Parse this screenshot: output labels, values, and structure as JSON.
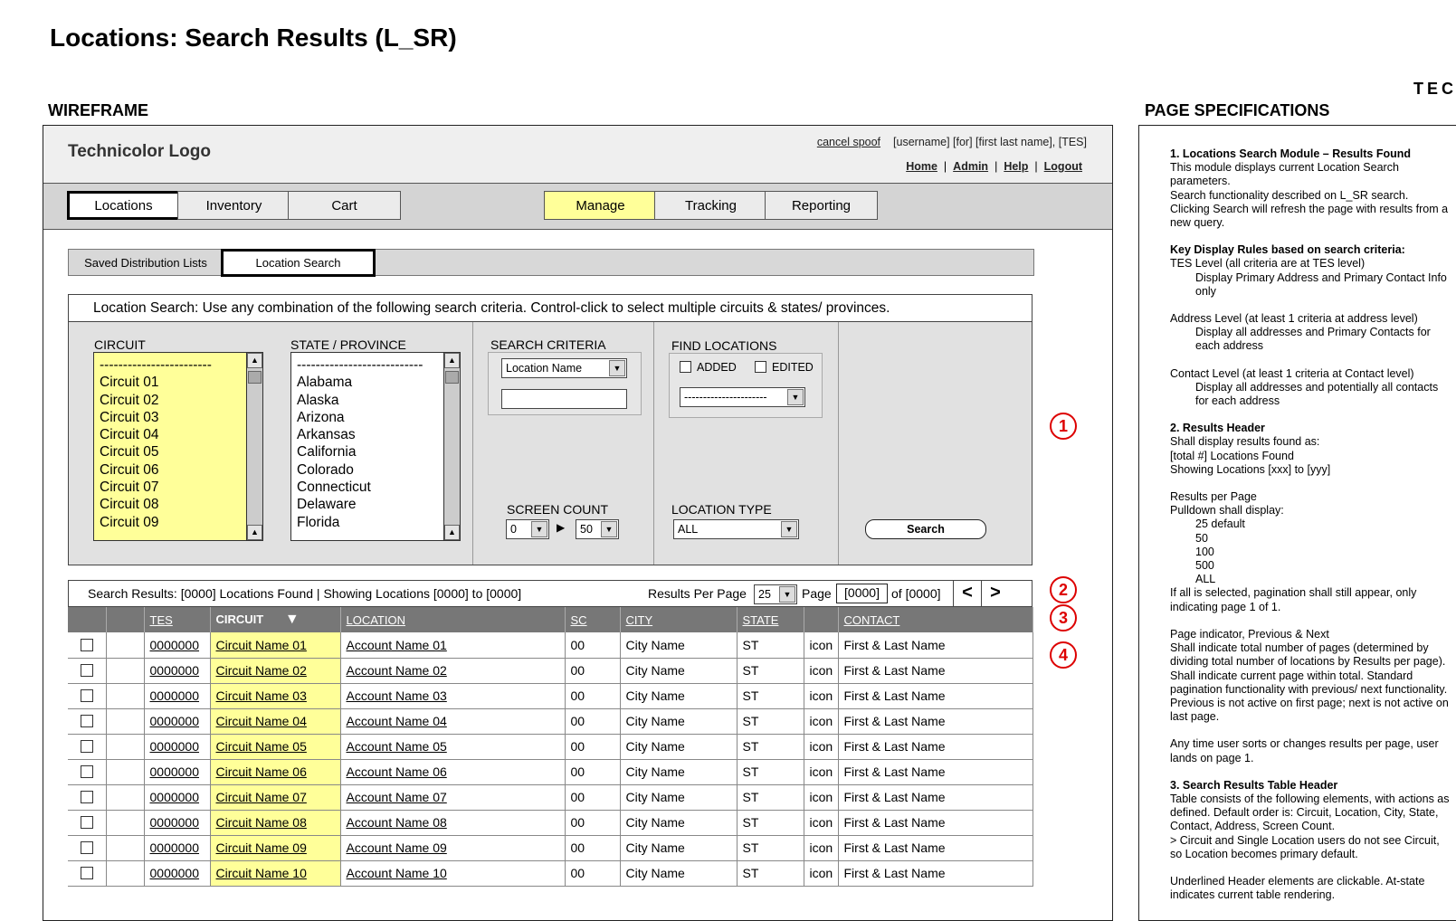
{
  "page_title": "Locations: Search Results (L_SR)",
  "wireframe_label": "WIREFRAME",
  "spec_label": "PAGE SPECIFICATIONS",
  "brand_corner": "TEC",
  "header": {
    "logo": "Technicolor Logo",
    "cancel_spoof": "cancel spoof",
    "user_info": "[username]  [for] [first last name], [TES]",
    "links": [
      "Home",
      "Admin",
      "Help",
      "Logout"
    ]
  },
  "nav": {
    "tabs": [
      "Locations",
      "Inventory",
      "Cart",
      "Manage",
      "Tracking",
      "Reporting"
    ],
    "selected": "Locations",
    "highlight": "Manage",
    "highlight_color": "#ffff99"
  },
  "subtabs": [
    "Saved Distribution Lists",
    "Location Search"
  ],
  "search": {
    "instructions": "Location Search: Use any combination of the following search criteria.  Control-click to select multiple circuits & states/ provinces.",
    "circuit_label": "CIRCUIT",
    "circuit_items": [
      "------------------------",
      "Circuit 01",
      "Circuit 02",
      "Circuit 03",
      "Circuit 04",
      "Circuit 05",
      "Circuit 06",
      "Circuit 07",
      "Circuit 08",
      "Circuit 09"
    ],
    "state_label": "STATE / PROVINCE",
    "state_items": [
      "---------------------------",
      "Alabama",
      "Alaska",
      "Arizona",
      "Arkansas",
      "California",
      "Colorado",
      "Connecticut",
      "Delaware",
      "Florida"
    ],
    "criteria_label": "SEARCH CRITERIA",
    "criteria_select": "Location Name",
    "criteria_text": "",
    "find_label": "FIND LOCATIONS",
    "added_label": "ADDED",
    "edited_label": "EDITED",
    "find_select": "----------------------",
    "screen_count_label": "SCREEN COUNT",
    "screen_from": "0",
    "screen_to": "50",
    "loc_type_label": "LOCATION TYPE",
    "loc_type": "ALL",
    "search_button": "Search"
  },
  "results_bar": {
    "summary": "Search Results: [0000] Locations Found |  Showing Locations [0000] to [0000]",
    "rpp_label": "Results Per Page",
    "rpp_value": "25",
    "page_label": "Page",
    "page_value": "[0000]",
    "of_text": "of [0000]",
    "prev": "<",
    "next": ">"
  },
  "table": {
    "headers": [
      "TES",
      "CIRCUIT",
      "LOCATION",
      "SC",
      "CITY",
      "STATE",
      "CONTACT"
    ],
    "sort_icon": "▼",
    "rows": [
      {
        "tes": "0000000",
        "circuit": "Circuit Name 01",
        "location": "Account Name 01",
        "sc": "00",
        "city": "City Name",
        "state": "ST",
        "icon": "icon",
        "contact": "First & Last Name"
      },
      {
        "tes": "0000000",
        "circuit": "Circuit Name 02",
        "location": "Account Name 02",
        "sc": "00",
        "city": "City Name",
        "state": "ST",
        "icon": "icon",
        "contact": "First & Last Name"
      },
      {
        "tes": "0000000",
        "circuit": "Circuit Name 03",
        "location": "Account Name 03",
        "sc": "00",
        "city": "City Name",
        "state": "ST",
        "icon": "icon",
        "contact": "First & Last Name"
      },
      {
        "tes": "0000000",
        "circuit": "Circuit Name 04",
        "location": "Account Name 04",
        "sc": "00",
        "city": "City Name",
        "state": "ST",
        "icon": "icon",
        "contact": "First & Last Name"
      },
      {
        "tes": "0000000",
        "circuit": "Circuit Name 05",
        "location": "Account Name 05",
        "sc": "00",
        "city": "City Name",
        "state": "ST",
        "icon": "icon",
        "contact": "First & Last Name"
      },
      {
        "tes": "0000000",
        "circuit": "Circuit Name 06",
        "location": "Account Name 06",
        "sc": "00",
        "city": "City Name",
        "state": "ST",
        "icon": "icon",
        "contact": "First & Last Name"
      },
      {
        "tes": "0000000",
        "circuit": "Circuit Name 07",
        "location": "Account Name 07",
        "sc": "00",
        "city": "City Name",
        "state": "ST",
        "icon": "icon",
        "contact": "First & Last Name"
      },
      {
        "tes": "0000000",
        "circuit": "Circuit Name 08",
        "location": "Account Name 08",
        "sc": "00",
        "city": "City Name",
        "state": "ST",
        "icon": "icon",
        "contact": "First & Last Name"
      },
      {
        "tes": "0000000",
        "circuit": "Circuit Name 09",
        "location": "Account Name 09",
        "sc": "00",
        "city": "City Name",
        "state": "ST",
        "icon": "icon",
        "contact": "First & Last Name"
      },
      {
        "tes": "0000000",
        "circuit": "Circuit Name 10",
        "location": "Account Name 10",
        "sc": "00",
        "city": "City Name",
        "state": "ST",
        "icon": "icon",
        "contact": "First & Last Name"
      }
    ]
  },
  "markers": [
    "1",
    "2",
    "3",
    "4"
  ],
  "marker_color": "#dd0000",
  "spec": [
    {
      "t": "1. Locations Search Module – Results Found",
      "s": "h"
    },
    {
      "t": "This module displays current Location Search parameters.",
      "s": ""
    },
    {
      "t": "Search functionality described on L_SR search.",
      "s": ""
    },
    {
      "t": "Clicking Search will refresh the page with results from a new query.",
      "s": ""
    },
    {
      "t": "",
      "s": "gap"
    },
    {
      "t": "Key Display Rules based on search criteria:",
      "s": "h"
    },
    {
      "t": "TES Level (all criteria are at TES level)",
      "s": ""
    },
    {
      "t": "Display Primary Address and Primary Contact Info only",
      "s": "ind"
    },
    {
      "t": "",
      "s": "gap"
    },
    {
      "t": "Address Level (at least 1 criteria at address level)",
      "s": ""
    },
    {
      "t": "Display all addresses and Primary Contacts for each address",
      "s": "ind"
    },
    {
      "t": "",
      "s": "gap"
    },
    {
      "t": "Contact Level (at least 1 criteria at Contact level)",
      "s": ""
    },
    {
      "t": "Display all addresses and potentially all contacts for each address",
      "s": "ind"
    },
    {
      "t": "",
      "s": "gap"
    },
    {
      "t": "2.  Results Header",
      "s": "h"
    },
    {
      "t": "Shall display results found as:",
      "s": ""
    },
    {
      "t": "[total #] Locations Found",
      "s": ""
    },
    {
      "t": "Showing Locations [xxx] to [yyy]",
      "s": ""
    },
    {
      "t": "",
      "s": "gap"
    },
    {
      "t": "Results per Page",
      "s": ""
    },
    {
      "t": "Pulldown shall display:",
      "s": ""
    },
    {
      "t": "25 default",
      "s": "ind"
    },
    {
      "t": "50",
      "s": "ind"
    },
    {
      "t": "100",
      "s": "ind"
    },
    {
      "t": "500",
      "s": "ind"
    },
    {
      "t": "ALL",
      "s": "ind"
    },
    {
      "t": "If all is selected, pagination shall still appear, only indicating page 1 of 1.",
      "s": ""
    },
    {
      "t": "",
      "s": "gap"
    },
    {
      "t": "Page indicator, Previous & Next",
      "s": ""
    },
    {
      "t": "Shall indicate total number of pages (determined by dividing total number of locations by Results per page).  Shall indicate current page within total.  Standard pagination functionality with previous/ next functionality.  Previous is not active on first page; next is not active on last page.",
      "s": ""
    },
    {
      "t": "",
      "s": "gap"
    },
    {
      "t": "Any time user sorts or changes results per page, user lands on page 1.",
      "s": ""
    },
    {
      "t": "",
      "s": "gap"
    },
    {
      "t": "3.  Search Results Table Header",
      "s": "h"
    },
    {
      "t": "Table consists of the following elements, with actions as defined.  Default order is: Circuit, Location, City, State, Contact, Address, Screen Count.",
      "s": ""
    },
    {
      "t": "> Circuit and Single Location users do not see Circuit, so Location becomes primary default.",
      "s": ""
    },
    {
      "t": "",
      "s": "gap"
    },
    {
      "t": "Underlined Header elements are clickable.  At-state indicates current table rendering.",
      "s": ""
    }
  ]
}
